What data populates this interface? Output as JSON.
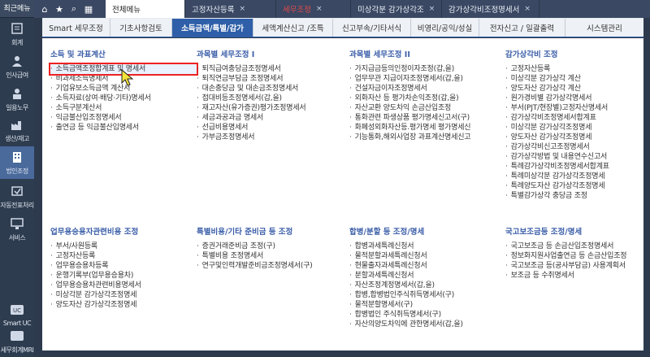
{
  "sidebar": {
    "top_label": "최근메뉴",
    "items": [
      {
        "label": "회계",
        "icon": "ledger-icon"
      },
      {
        "label": "인사급여",
        "icon": "person-icon"
      },
      {
        "label": "일용노무",
        "icon": "worker-icon"
      },
      {
        "label": "생산/재고",
        "icon": "factory-icon"
      },
      {
        "label": "법인조정",
        "icon": "building-icon"
      },
      {
        "label": "자동전표처리",
        "icon": "auto-entry-icon"
      },
      {
        "label": "서비스",
        "icon": "monitor-icon"
      },
      {
        "label": "Smart UC",
        "icon": "smart-uc-icon"
      },
      {
        "label": "세무회계MRI",
        "icon": "mri-icon"
      }
    ]
  },
  "topbar": {
    "icons": [
      "home-icon",
      "star-icon",
      "search-icon",
      "calendar-icon"
    ],
    "tabs": [
      {
        "label": "전체메뉴"
      },
      {
        "label": "고정자산등록"
      },
      {
        "label": "세무조정",
        "red": true
      },
      {
        "label": "미상각분 감가상각조"
      },
      {
        "label": "감가상각비조정명세서"
      }
    ]
  },
  "menubar": {
    "tabs": [
      {
        "label": "Smart 세무조정"
      },
      {
        "label": "기초사항검토"
      },
      {
        "label": "소득금액/특별/감가",
        "active": true
      },
      {
        "label": "세액계산신고 /조특"
      },
      {
        "label": "신고부속/기타서식"
      },
      {
        "label": "비영리/공익/성실"
      },
      {
        "label": "전자신고 / 일괄출력"
      },
      {
        "label": "시스템관리"
      }
    ]
  },
  "sections": {
    "income": {
      "title": "소득 및 과표계산",
      "items": [
        "소득금액조정합계표 및 명세서",
        "비과세소득명세서",
        "기업유보소득금액 계산서",
        "소득자료(상여·배당·기타)명세서",
        "소득구분계산서",
        "익금불산입조정명세서",
        "출연금 등 익금불산입명세서"
      ]
    },
    "tax_adj1": {
      "title": "과목별 세무조정 I",
      "items": [
        "퇴직급여충당금조정명세서",
        "퇴직연금부담금 조정명세서",
        "대손충당금 및 대손금조정명세서",
        "접대비등조정명세서(갑,을)",
        "재고자산(유가증권)평가조정명세서",
        "세금과공과금 명세서",
        "선급비용명세서",
        "가부금조정명세서"
      ]
    },
    "tax_adj2": {
      "title": "과목별 세무조정 II",
      "items": [
        "가지급금등의인정이자조정(갑,을)",
        "업무무관 지급이자조정명세서(갑,을)",
        "건설자금이자조정명세서",
        "외화자산 등 평가차손익조정(갑,을)",
        "자산교환 양도차익 손금산입조정",
        "통화관련 파생상품 평가명세신고서(구)",
        "화폐성외화자산등.평가명세 평가명세신",
        "기능통화,해외사업장 과표계산명세신고"
      ]
    },
    "depreciation": {
      "title": "감가상각비 조정",
      "items": [
        "고정자산등록",
        "미상각분 감가상각 계산",
        "양도자산 감가상각 계산",
        "원가경비별 감가상각명세서",
        "부서(PJT/현장별)고정자산명세서",
        "감가상각비조정명세서합계표",
        "미상각분 감가상각조정명세",
        "양도자산 감가상각조정명세",
        "감가상각비신고조정명세서",
        "감가상각방법 및 내용연수신고서",
        "특례감가상각비조정명세서합계표",
        "특례미상각분 감가상각조정명세",
        "특례양도자산 감가상각조정명세",
        "특별감가상각 충당금 조정"
      ]
    },
    "business_car": {
      "title": "업무용승용자관련비용 조정",
      "items": [
        "부서/사원등록",
        "고정자산등록",
        "업무용승용차등록",
        "운행기록부(업무용승용차)",
        "업무용승용차관련비용명세서",
        "미상각분 감가상각조정명세",
        "양도자산 감가상각조정명세"
      ]
    },
    "special_reserve": {
      "title": "특별비용/기타 준비금 등 조정",
      "items": [
        "증권거래준비금 조정(구)",
        "특별비용 조정명세서",
        "연구및인력개발준비금조정명세서(구)"
      ]
    },
    "merger": {
      "title": "합병/분할 등 조정/명세",
      "items": [
        "합병과세특례신청서",
        "물적분할과세특례신청서",
        "현물출자과세특례신청서",
        "분할과세특례신청서",
        "자산조정계정명세서(갑,을)",
        "합병,합병법인주식취득명세서(구)",
        "물적분할명세서(구)",
        "합병법인 주식취득명세서(구)",
        "자산의양도차익에 관한명세서(갑,을)"
      ]
    },
    "intl_tax": {
      "title": "국고보조금등 조정/명세",
      "items": [
        "국고보조금 등 손금산입조정명세서",
        "정보화지원사업출연금 등 손금산입조정",
        "국고보조금 등(공사부담금) 사용계획서",
        "보조금 등 수취명세서"
      ]
    }
  }
}
